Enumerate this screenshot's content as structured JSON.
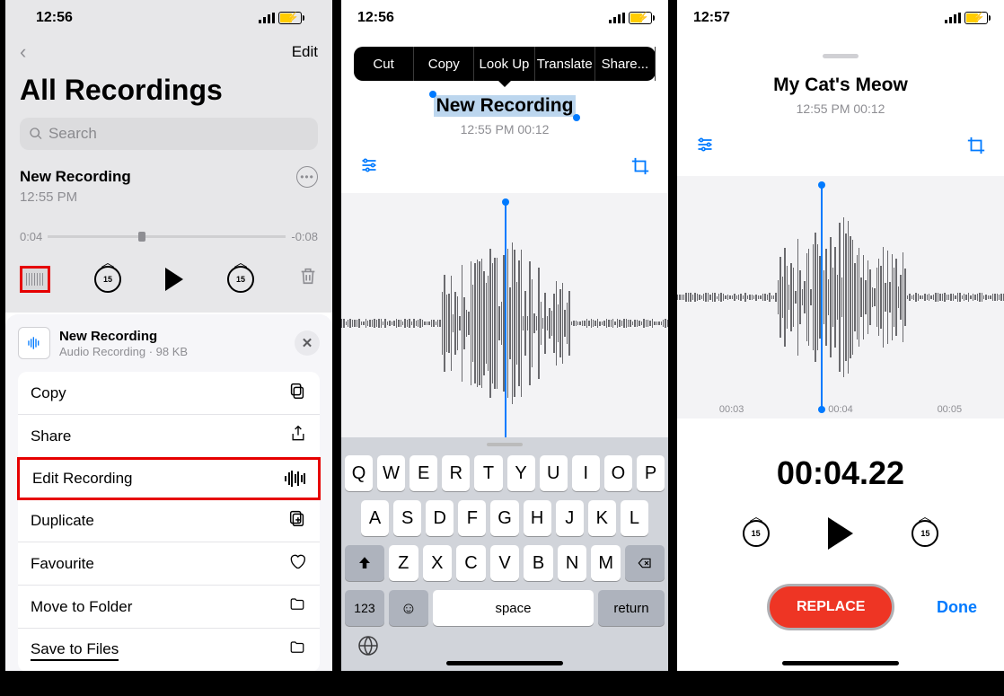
{
  "screen1": {
    "status": {
      "time": "12:56"
    },
    "toolbar": {
      "edit": "Edit"
    },
    "title": "All Recordings",
    "search": {
      "placeholder": "Search"
    },
    "recording": {
      "name": "New Recording",
      "time": "12:55 PM",
      "pos": "0:04",
      "remain": "-0:08",
      "skip": "15"
    },
    "sheet": {
      "title": "New Recording",
      "subtitle": "Audio Recording · 98 KB",
      "items": {
        "copy": "Copy",
        "share": "Share",
        "edit": "Edit Recording",
        "duplicate": "Duplicate",
        "favourite": "Favourite",
        "move": "Move to Folder",
        "save": "Save to Files"
      }
    }
  },
  "screen2": {
    "status": {
      "time": "12:56"
    },
    "menu": {
      "cut": "Cut",
      "copy": "Copy",
      "lookup": "Look Up",
      "translate": "Translate",
      "share": "Share..."
    },
    "title": "New Recording",
    "subtitle": "12:55 PM  00:12",
    "keyboard": {
      "r1": [
        "Q",
        "W",
        "E",
        "R",
        "T",
        "Y",
        "U",
        "I",
        "O",
        "P"
      ],
      "r2": [
        "A",
        "S",
        "D",
        "F",
        "G",
        "H",
        "J",
        "K",
        "L"
      ],
      "r3": [
        "Z",
        "X",
        "C",
        "V",
        "B",
        "N",
        "M"
      ],
      "n123": "123",
      "space": "space",
      "return": "return"
    }
  },
  "screen3": {
    "status": {
      "time": "12:57"
    },
    "title": "My Cat's Meow",
    "subtitle": "12:55 PM  00:12",
    "ruler": [
      "00:03",
      "00:04",
      "00:05"
    ],
    "bigtime": "00:04.22",
    "skip": "15",
    "replace": "REPLACE",
    "done": "Done"
  }
}
